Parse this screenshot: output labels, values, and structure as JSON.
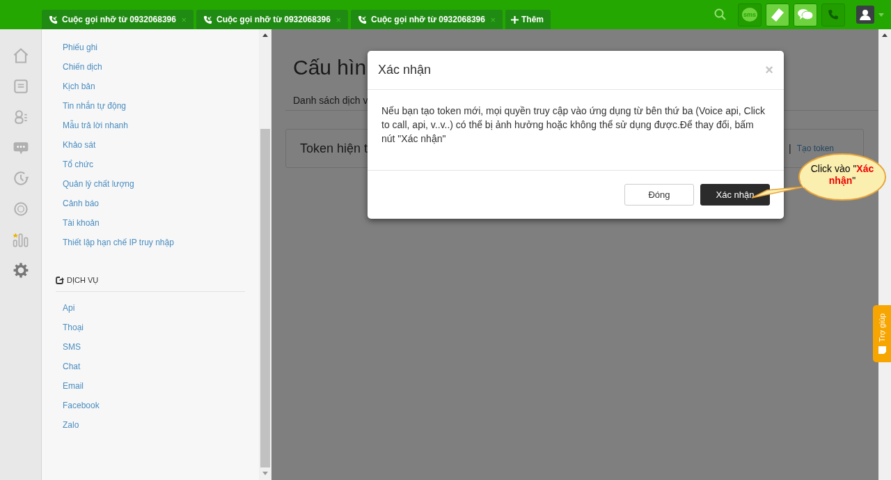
{
  "top_bar": {
    "call_tabs": [
      {
        "label": "Cuộc gọi nhỡ từ 0932068396",
        "close": "×"
      },
      {
        "label": "Cuộc gọi nhỡ từ 0932068396",
        "close": "×"
      },
      {
        "label": "Cuộc gọi nhỡ từ 0932068396",
        "close": "×"
      }
    ],
    "add_tab": {
      "label": "Thêm"
    },
    "sms_badge": "sms"
  },
  "icon_rail": [
    {
      "kind": "home",
      "selected": false
    },
    {
      "kind": "inbox",
      "selected": false
    },
    {
      "kind": "contacts",
      "selected": false
    },
    {
      "kind": "chat",
      "selected": false
    },
    {
      "kind": "history",
      "selected": false
    },
    {
      "kind": "circle",
      "selected": false
    },
    {
      "kind": "reports",
      "selected": false
    },
    {
      "kind": "settings",
      "selected": true
    }
  ],
  "sidebar": {
    "items": [
      "Phiếu ghi",
      "Chiến dịch",
      "Kịch bản",
      "Tin nhắn tự động",
      "Mẫu trả lời nhanh",
      "Khảo sát",
      "Tổ chức",
      "Quản lý chất lượng",
      "Cảnh báo",
      "Tài khoản",
      "Thiết lập hạn chế IP truy nhập"
    ],
    "section": {
      "title": "DỊCH VỤ",
      "items": [
        "Api",
        "Thoại",
        "SMS",
        "Chat",
        "Email",
        "Facebook",
        "Zalo"
      ]
    }
  },
  "page": {
    "title": "Cấu hìn",
    "tab_label": "Danh sách dịch v",
    "card_title": "Token hiện t",
    "separator": "|",
    "card_link": "Tạo token"
  },
  "dialog": {
    "title": "Xác nhận",
    "close": "×",
    "message": "Nếu bạn tạo token mới, mọi quyền truy cập vào ứng dụng từ bên thứ ba (Voice api, Click to call, api, v..v..) có thể bị ảnh hưởng hoặc không thể sử dụng được.Để thay đổi, bấm nút \"Xác nhận\"",
    "buttons": [
      {
        "label": "Đóng",
        "kind": "default"
      },
      {
        "label": "Xác nhận",
        "kind": "primary"
      }
    ]
  },
  "callout": {
    "text": "Click vào \"**Xác nhận**\""
  },
  "help_tab": {
    "label": "Trợ giúp"
  }
}
